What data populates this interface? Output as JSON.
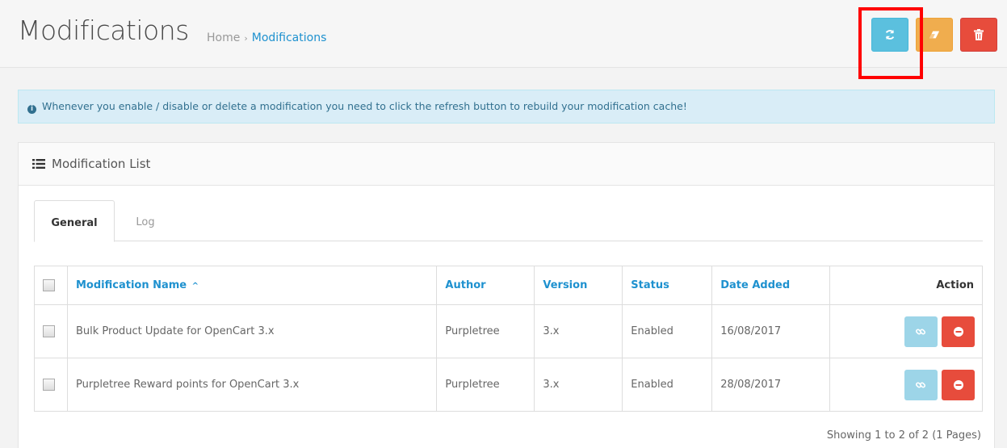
{
  "header": {
    "title": "Modifications",
    "breadcrumb": [
      {
        "label": "Home"
      },
      {
        "label": "Modifications"
      }
    ],
    "buttons": {
      "refresh_icon": "refresh-icon",
      "clear_icon": "eraser-icon",
      "delete_icon": "trash-icon"
    }
  },
  "alert": {
    "text": "Whenever you enable / disable or delete a modification you need to click the refresh button to rebuild your modification cache!"
  },
  "panel": {
    "title": "Modification List",
    "tabs": [
      {
        "label": "General",
        "active": true
      },
      {
        "label": "Log",
        "active": false
      }
    ],
    "table": {
      "columns": {
        "name": "Modification Name",
        "author": "Author",
        "version": "Version",
        "status": "Status",
        "date_added": "Date Added",
        "action": "Action"
      },
      "rows": [
        {
          "name": "Bulk Product Update for OpenCart 3.x",
          "author": "Purpletree",
          "version": "3.x",
          "status": "Enabled",
          "date_added": "16/08/2017"
        },
        {
          "name": "Purpletree Reward points for OpenCart 3.x",
          "author": "Purpletree",
          "version": "3.x",
          "status": "Enabled",
          "date_added": "28/08/2017"
        }
      ]
    },
    "pagination_text": "Showing 1 to 2 of 2 (1 Pages)"
  },
  "colors": {
    "primary": "#1e91cf",
    "info": "#5bc0de",
    "warning": "#f0ad4e",
    "danger": "#e74c3c",
    "highlight": "#ff0000"
  }
}
